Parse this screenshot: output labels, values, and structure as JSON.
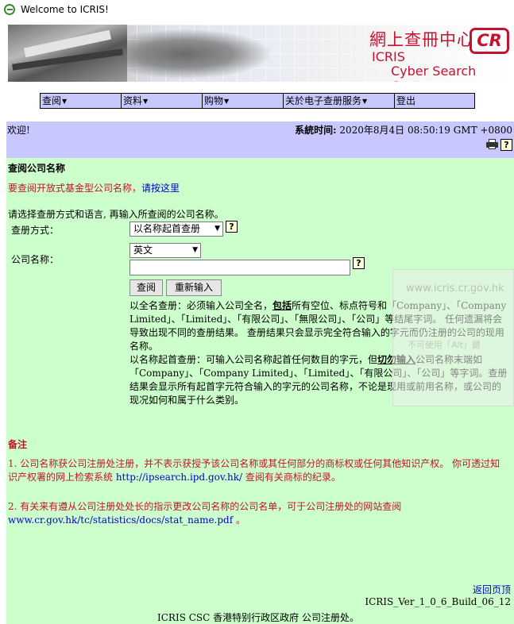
{
  "window": {
    "title": "Welcome to ICRIS!"
  },
  "banner": {
    "cn_title": "網上查冊中心",
    "logo": "CR",
    "en_line1": "ICRIS",
    "en_line2": "Cyber Search Centre"
  },
  "menu": [
    {
      "label": "查阅"
    },
    {
      "label": "资料"
    },
    {
      "label": "购物"
    },
    {
      "label": "关於电子查册服务"
    },
    {
      "label": "登出"
    }
  ],
  "status": {
    "welcome": "欢迎!",
    "time_label": "系統时间:",
    "time_value": " 2020年8月4日 08:50:19 GMT +0800"
  },
  "page": {
    "title": "查阅公司名称",
    "open_fund_text": "要查阅开放式基金型公司名称，",
    "open_fund_link": "请按这里",
    "instruction": "请选择查册方式和语言, 再输入所查阅的公司名称。",
    "method_label": "查册方式：",
    "method_value": "以名称起首查册",
    "name_label": "公司名称：",
    "lang_value": "英文",
    "name_value": "",
    "search_button": "查阅",
    "reset_button": "重新输入",
    "desc1_a": "以全名查册：必须输入公司全名，",
    "desc1_b": "包括",
    "desc1_c": "所有空位、标点符号和「Company」、「Company Limited」、「Limited」、「有限公司」、「無限公司」、「公司」等结尾字词。 任何遗漏将会导致出现不同的查册结果。 查册结果只会显示完全符合输入的字元而仍注册的公司的现用名称。",
    "desc2_a": "以名称起首查册：可输入公司名称起首任何数目的字元，但",
    "desc2_b": "切勿输入",
    "desc2_c": "公司名称末端如「Company」、「Company Limited」、「Limited」、「有限公司」、「公司」等字词。查册结果会显示所有起首字元符合输入的字元的公司名称，不论是现用或前用名称，或公司的现况如何和属于什么类别。"
  },
  "remarks": {
    "title": "备注",
    "note1_a": "1.  公司名称获公司注册处注册，并不表示获授予该公司名称或其任何部分的商标权或任何其他知识产权。 你可透过知识产权署的网上检索系统 ",
    "note1_url": "http://ipsearch.ipd.gov.hk/",
    "note1_b": " 查阅有关商标的纪录。",
    "note2_a": "2.  有关来有遵从公司注册处处长的指示更改公司名称的公司名单，可于公司注册处的网站查阅 ",
    "note2_url": "www.cr.gov.hk/tc/statistics/docs/stat_name.pdf",
    "note2_b": " 。"
  },
  "footer": {
    "back_to_top": "返回页顶",
    "build": "ICRIS_Ver_1_0_6_Build_06_12",
    "copyright": "ICRIS CSC 香港特别行政区政府 公司注册处。"
  },
  "overlay": {
    "url": "www.icris.cr.gov.hk",
    "hint": "不可使用「Alt」鍵"
  },
  "colors": {
    "menu_bg": "#c8c8ff",
    "main_bg": "#ccffcc",
    "accent_red": "#c4122f",
    "link_blue": "#0000cc"
  }
}
